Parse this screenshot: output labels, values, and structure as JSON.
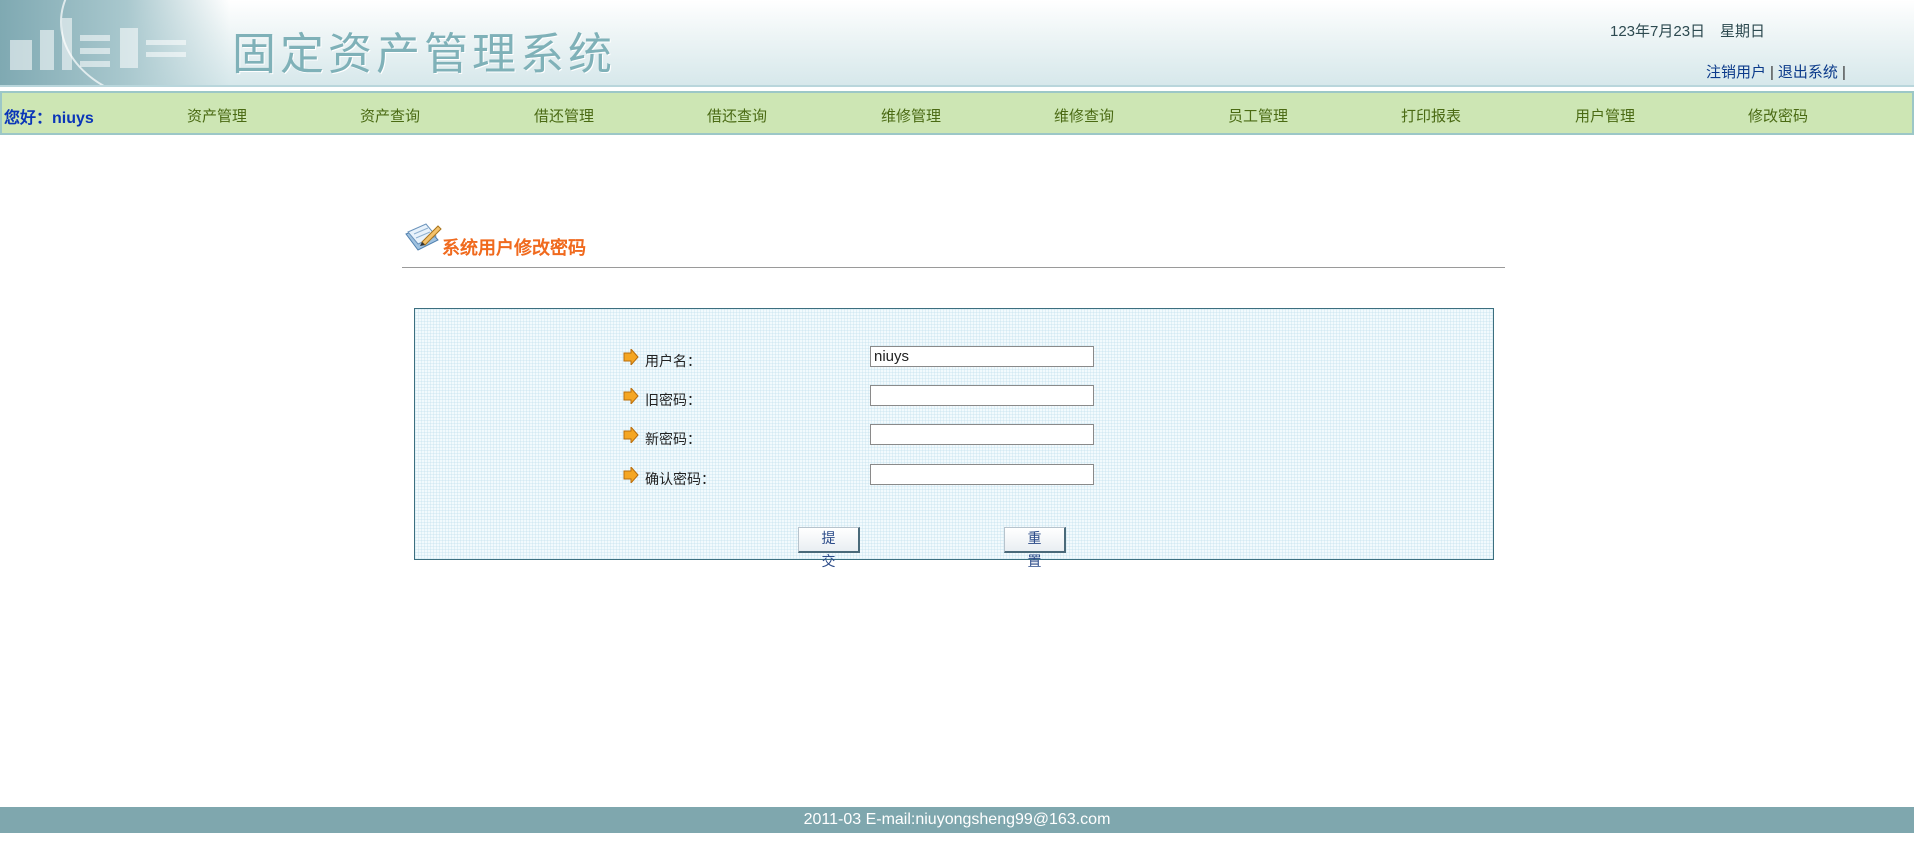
{
  "header": {
    "logo_title": "固定资产管理系统",
    "date": "123年7月23日　星期日",
    "links": [
      {
        "label": "注销用户"
      },
      {
        "label": "退出系统"
      }
    ],
    "separator": "|"
  },
  "nav": {
    "greeting": "您好：niuys",
    "items": [
      {
        "label": "资产管理"
      },
      {
        "label": "资产查询"
      },
      {
        "label": "借还管理"
      },
      {
        "label": "借还查询"
      },
      {
        "label": "维修管理"
      },
      {
        "label": "维修查询"
      },
      {
        "label": "员工管理"
      },
      {
        "label": "打印报表"
      },
      {
        "label": "用户管理"
      },
      {
        "label": "修改密码"
      }
    ]
  },
  "page": {
    "title": "系统用户修改密码"
  },
  "form": {
    "fields": [
      {
        "label": "用户名：",
        "value": "niuys"
      },
      {
        "label": "旧密码：",
        "value": ""
      },
      {
        "label": "新密码：",
        "value": ""
      },
      {
        "label": "确认密码：",
        "value": ""
      }
    ],
    "submit_label": "提交",
    "reset_label": "重置"
  },
  "footer": {
    "text": "2011-03 E-mail:niuyongsheng99@163.com"
  },
  "colors": {
    "nav_bg": "#cde6b4",
    "title_orange": "#f06a1e",
    "greeting_blue": "#0a35b8",
    "footer_bg": "#7fa7ae"
  }
}
